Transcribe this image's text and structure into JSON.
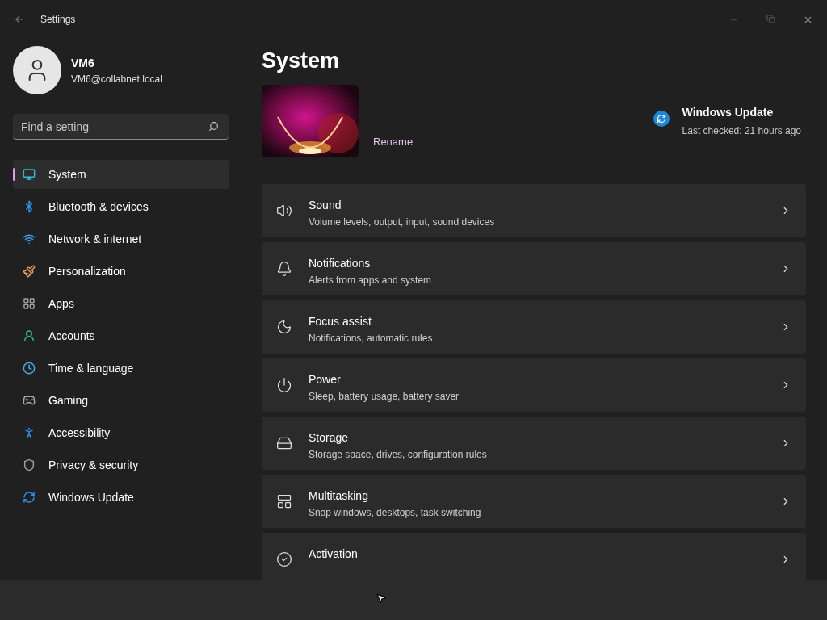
{
  "window": {
    "title": "Settings"
  },
  "user": {
    "name": "VM6",
    "email": "VM6@collabnet.local"
  },
  "search": {
    "placeholder": "Find a setting"
  },
  "nav": [
    {
      "label": "System",
      "kind": "system",
      "selected": true
    },
    {
      "label": "Bluetooth & devices",
      "kind": "bluetooth",
      "selected": false
    },
    {
      "label": "Network & internet",
      "kind": "network",
      "selected": false
    },
    {
      "label": "Personalization",
      "kind": "brush",
      "selected": false
    },
    {
      "label": "Apps",
      "kind": "apps",
      "selected": false
    },
    {
      "label": "Accounts",
      "kind": "accounts",
      "selected": false
    },
    {
      "label": "Time & language",
      "kind": "time",
      "selected": false
    },
    {
      "label": "Gaming",
      "kind": "gaming",
      "selected": false
    },
    {
      "label": "Accessibility",
      "kind": "accessibility",
      "selected": false
    },
    {
      "label": "Privacy & security",
      "kind": "privacy",
      "selected": false
    },
    {
      "label": "Windows Update",
      "kind": "update",
      "selected": false
    }
  ],
  "page": {
    "title": "System",
    "rename": "Rename",
    "update": {
      "title": "Windows Update",
      "status": "Last checked: 21 hours ago"
    }
  },
  "cards": [
    {
      "kind": "sound",
      "title": "Sound",
      "subtitle": "Volume levels, output, input, sound devices"
    },
    {
      "kind": "notifications",
      "title": "Notifications",
      "subtitle": "Alerts from apps and system"
    },
    {
      "kind": "focus",
      "title": "Focus assist",
      "subtitle": "Notifications, automatic rules"
    },
    {
      "kind": "power",
      "title": "Power",
      "subtitle": "Sleep, battery usage, battery saver"
    },
    {
      "kind": "storage",
      "title": "Storage",
      "subtitle": "Storage space, drives, configuration rules"
    },
    {
      "kind": "multitasking",
      "title": "Multitasking",
      "subtitle": "Snap windows, desktops, task switching"
    },
    {
      "kind": "activation",
      "title": "Activation"
    }
  ]
}
